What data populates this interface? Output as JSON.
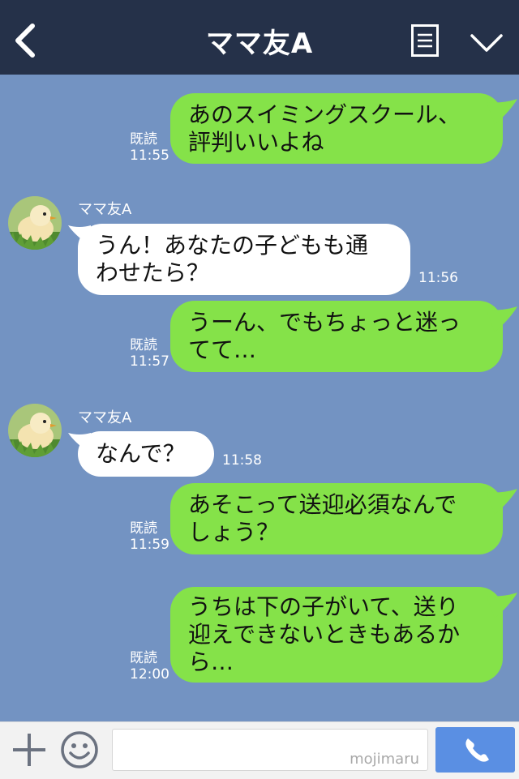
{
  "header": {
    "title": "ママ友A",
    "back_icon": "chevron-left-icon",
    "menu_icon": "menu-icon",
    "collapse_icon": "chevron-down-icon"
  },
  "messages": [
    {
      "dir": "out",
      "read": "既読",
      "time": "11:55",
      "lines": [
        "あのスイミングスクール、",
        "評判いいよね"
      ]
    },
    {
      "dir": "in",
      "sender": "ママ友A",
      "time": "11:56",
      "lines": [
        "うん！あなたの子どもも通",
        "わせたら？"
      ]
    },
    {
      "dir": "out",
      "read": "既読",
      "time": "11:57",
      "lines": [
        "うーん、でもちょっと迷っ",
        "てて…"
      ]
    },
    {
      "dir": "in",
      "sender": "ママ友A",
      "time": "11:58",
      "lines": [
        "なんで？"
      ]
    },
    {
      "dir": "out",
      "read": "既読",
      "time": "11:59",
      "lines": [
        "あそこって送迎必須なんで",
        "しょう？"
      ]
    },
    {
      "dir": "out",
      "read": "既読",
      "time": "12:00",
      "lines": [
        "うちは下の子がいて、送り",
        "迎えできないときもあるか",
        "ら…"
      ]
    }
  ],
  "footer": {
    "input_value": "",
    "watermark": "mojimaru",
    "plus_icon": "plus-icon",
    "emoji_icon": "smiley-icon",
    "call_icon": "phone-icon"
  },
  "colors": {
    "header_bg": "#253149",
    "chat_bg": "#7393c2",
    "out_bubble": "#85e249",
    "in_bubble": "#ffffff",
    "call_button": "#5a8fe3"
  }
}
